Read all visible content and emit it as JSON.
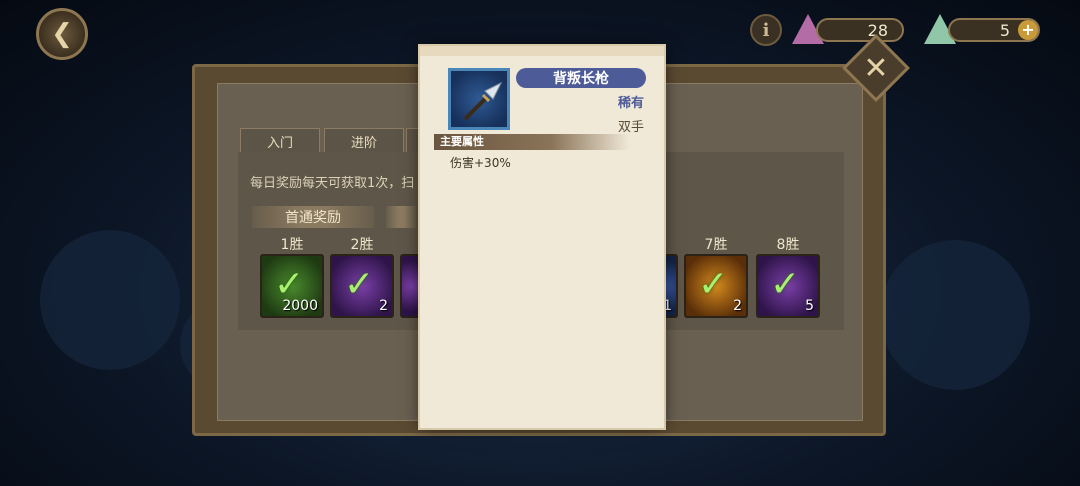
{
  "topbar": {
    "resource_1": "28",
    "resource_2": "5",
    "info_label": "i",
    "plus_label": "+"
  },
  "tabs": [
    "入门",
    "进阶"
  ],
  "description": "每日奖励每天可获取1次，扫",
  "ribbon_label": "首通奖励",
  "rewards": [
    {
      "label": "1胜",
      "count": "2000",
      "color": "green"
    },
    {
      "label": "2胜",
      "count": "2",
      "color": "purple"
    },
    {
      "label": "",
      "count": "1",
      "color": "blue"
    },
    {
      "label": "7胜",
      "count": "2",
      "color": "orange"
    },
    {
      "label": "8胜",
      "count": "5",
      "color": "purple"
    }
  ],
  "tooltip": {
    "item_name": "背叛长枪",
    "rarity": "稀有",
    "hand_type": "双手",
    "section_title": "主要属性",
    "attribute": "伤害+30%"
  },
  "colors": {
    "name_bar": "#4d5c98",
    "rarity_text": "#4d5c98",
    "paper": "#f1e9d8",
    "panel_border": "#7d6846"
  }
}
